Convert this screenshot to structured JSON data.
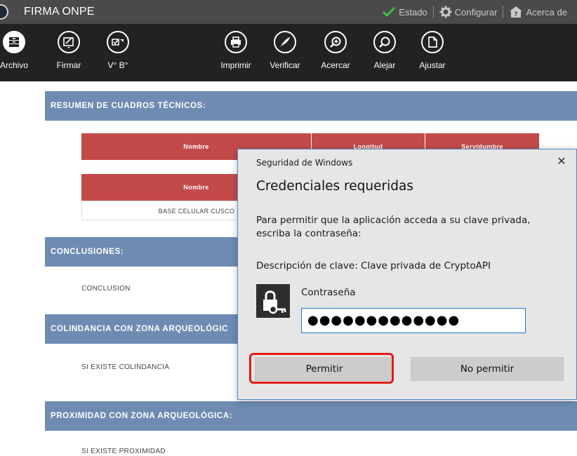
{
  "app": {
    "title": "FIRMA ONPE",
    "menu": [
      {
        "label": "Estado",
        "icon": "check-icon"
      },
      {
        "label": "Configurar",
        "icon": "gear-icon"
      },
      {
        "label": "Acerca de",
        "icon": "help-icon"
      }
    ]
  },
  "toolbar": {
    "items": [
      {
        "label": "Archivo",
        "icon": "archive-icon"
      },
      {
        "label": "Firmar",
        "icon": "sign-icon"
      },
      {
        "label": "V° B°",
        "icon": "approve-icon"
      },
      {
        "label": "Imprimir",
        "icon": "print-icon"
      },
      {
        "label": "Verificar",
        "icon": "verify-quill-icon"
      },
      {
        "label": "Acercar",
        "icon": "zoom-in-icon"
      },
      {
        "label": "Alejar",
        "icon": "zoom-out-icon"
      },
      {
        "label": "Ajustar",
        "icon": "fit-page-icon"
      }
    ]
  },
  "document": {
    "sections": [
      {
        "title": "RESUMEN DE CUADROS TÉCNICOS:"
      },
      {
        "title": "CONCLUSIONES:",
        "text": "CONCLUSION"
      },
      {
        "title": "COLINDANCIA CON ZONA ARQUEOLÓGIC",
        "text": "SI EXISTE COLINDANCIA"
      },
      {
        "title": "PROXIMIDAD CON ZONA ARQUEOLÓGICA:",
        "text": "SI EXISTE PROXIMIDAD"
      }
    ],
    "table1": {
      "headers": [
        "Nombre",
        "Longitud",
        "Servidumbre"
      ]
    },
    "table2": {
      "headers": [
        "Nombre"
      ],
      "rows": [
        "BASE CELULAR CUSCO"
      ]
    }
  },
  "dialog": {
    "window_title": "Seguridad de Windows",
    "close_glyph": "✕",
    "heading": "Credenciales requeridas",
    "message": "Para permitir que la aplicación acceda a su clave privada, escriba la contraseña:",
    "key_description": "Descripción de clave: Clave privada de CryptoAPI",
    "password_label": "Contraseña",
    "password_value": "●●●●●●●●●●●●●",
    "allow_label": "Permitir",
    "deny_label": "No permitir",
    "highlight_color": "#e31a1a",
    "accent_color": "#1e78d4"
  }
}
